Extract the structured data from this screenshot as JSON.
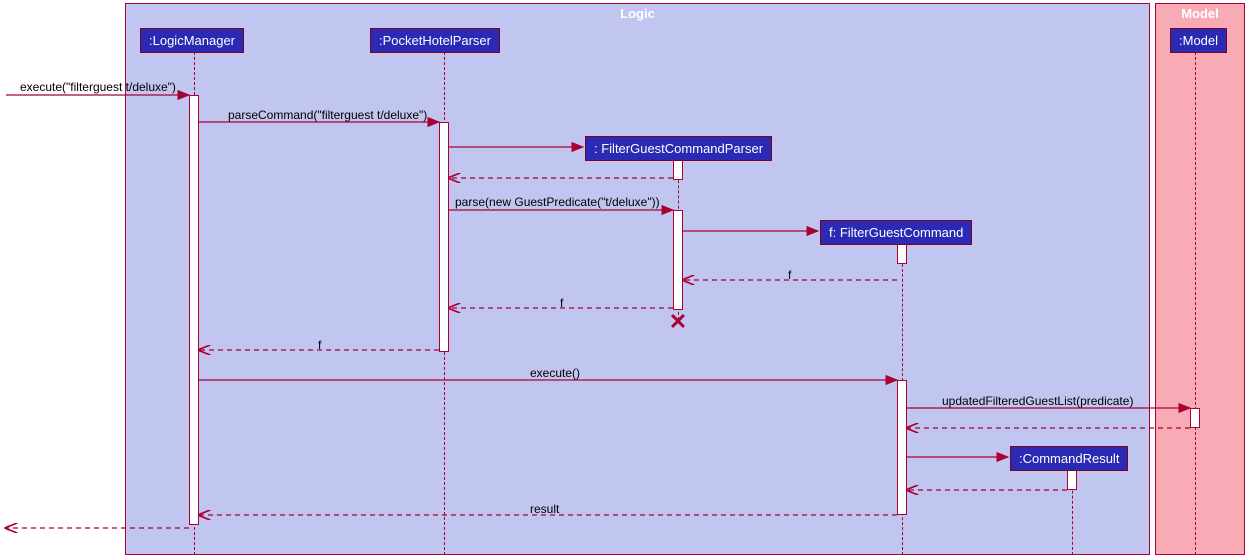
{
  "frames": {
    "logic": {
      "label": "Logic"
    },
    "model": {
      "label": "Model"
    }
  },
  "participants": {
    "logicManager": ":LogicManager",
    "pocketHotelParser": ":PocketHotelParser",
    "filterGuestCommandParser": ":  FilterGuestCommandParser",
    "filterGuestCommand": "f:  FilterGuestCommand",
    "commandResult": ":CommandResult",
    "model": ":Model"
  },
  "messages": {
    "execute1": "execute(\"filterguest t/deluxe\")",
    "parseCommand": "parseCommand(\"filterguest t/deluxe\")",
    "parse": "parse(new GuestPredicate(\"t/deluxe\"))",
    "return_f1": "f",
    "return_f2": "f",
    "return_f3": "f",
    "execute2": "execute()",
    "updateFiltered": "updatedFilteredGuestList(predicate)",
    "result": "result"
  },
  "chart_data": {
    "type": "sequence_diagram",
    "frames": [
      "Logic",
      "Model"
    ],
    "participants": [
      {
        "name": ":LogicManager",
        "frame": "Logic"
      },
      {
        "name": ":PocketHotelParser",
        "frame": "Logic"
      },
      {
        "name": ":FilterGuestCommandParser",
        "frame": "Logic",
        "created": true,
        "destroyed": true
      },
      {
        "name": "f:FilterGuestCommand",
        "frame": "Logic",
        "created": true
      },
      {
        "name": ":CommandResult",
        "frame": "Logic",
        "created": true
      },
      {
        "name": ":Model",
        "frame": "Model"
      }
    ],
    "messages": [
      {
        "from": "external",
        "to": ":LogicManager",
        "label": "execute(\"filterguest t/deluxe\")",
        "type": "sync"
      },
      {
        "from": ":LogicManager",
        "to": ":PocketHotelParser",
        "label": "parseCommand(\"filterguest t/deluxe\")",
        "type": "sync"
      },
      {
        "from": ":PocketHotelParser",
        "to": ":FilterGuestCommandParser",
        "label": "",
        "type": "create"
      },
      {
        "from": ":FilterGuestCommandParser",
        "to": ":PocketHotelParser",
        "label": "",
        "type": "return"
      },
      {
        "from": ":PocketHotelParser",
        "to": ":FilterGuestCommandParser",
        "label": "parse(new GuestPredicate(\"t/deluxe\"))",
        "type": "sync"
      },
      {
        "from": ":FilterGuestCommandParser",
        "to": "f:FilterGuestCommand",
        "label": "",
        "type": "create"
      },
      {
        "from": "f:FilterGuestCommand",
        "to": ":FilterGuestCommandParser",
        "label": "f",
        "type": "return"
      },
      {
        "from": ":FilterGuestCommandParser",
        "to": ":PocketHotelParser",
        "label": "f",
        "type": "return"
      },
      {
        "from": ":PocketHotelParser",
        "to": ":LogicManager",
        "label": "f",
        "type": "return"
      },
      {
        "from": ":LogicManager",
        "to": "f:FilterGuestCommand",
        "label": "execute()",
        "type": "sync"
      },
      {
        "from": "f:FilterGuestCommand",
        "to": ":Model",
        "label": "updatedFilteredGuestList(predicate)",
        "type": "sync"
      },
      {
        "from": ":Model",
        "to": "f:FilterGuestCommand",
        "label": "",
        "type": "return"
      },
      {
        "from": "f:FilterGuestCommand",
        "to": ":CommandResult",
        "label": "",
        "type": "create"
      },
      {
        "from": ":CommandResult",
        "to": "f:FilterGuestCommand",
        "label": "",
        "type": "return"
      },
      {
        "from": "f:FilterGuestCommand",
        "to": ":LogicManager",
        "label": "result",
        "type": "return"
      },
      {
        "from": ":LogicManager",
        "to": "external",
        "label": "",
        "type": "return"
      }
    ]
  }
}
